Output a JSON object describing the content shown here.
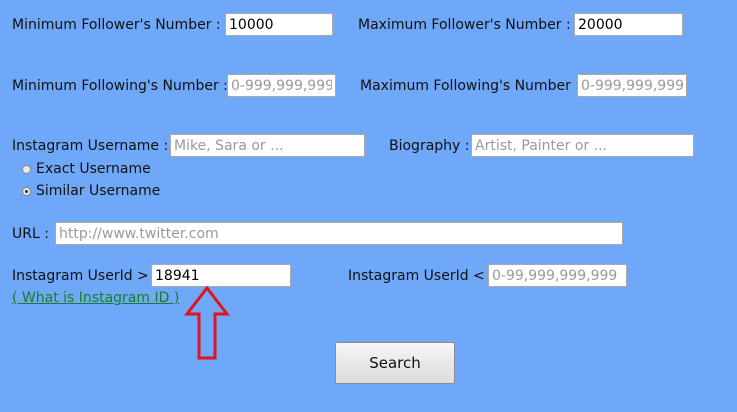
{
  "fields": {
    "min_followers": {
      "label": "Minimum Follower's Number :",
      "value": "10000",
      "placeholder": ""
    },
    "max_followers": {
      "label": "Maximum Follower's Number :",
      "value": "20000",
      "placeholder": ""
    },
    "min_following": {
      "label": "Minimum Following's Number :",
      "value": "",
      "placeholder": "0-999,999,999"
    },
    "max_following": {
      "label": "Maximum Following's Number :",
      "value": "",
      "placeholder": "0-999,999,999"
    },
    "username": {
      "label": "Instagram Username :",
      "value": "",
      "placeholder": "Mike, Sara or ..."
    },
    "biography": {
      "label": "Biography :",
      "value": "",
      "placeholder": "Artist, Painter or ..."
    },
    "url": {
      "label": "URL :",
      "value": "",
      "placeholder": "http://www.twitter.com"
    },
    "userid_min": {
      "label": "Instagram UserId >",
      "value": "18941",
      "placeholder": ""
    },
    "userid_max": {
      "label": "Instagram UserId <",
      "value": "",
      "placeholder": "0-99,999,999,999"
    }
  },
  "username_match": {
    "options": [
      {
        "label": "Exact Username",
        "checked": false
      },
      {
        "label": "Similar Username",
        "checked": true
      }
    ]
  },
  "help_link": "( What is Instagram ID )",
  "search_button": "Search",
  "colors": {
    "background": "#6fa8f8",
    "link": "#1a7e28",
    "arrow": "#e0141c"
  }
}
